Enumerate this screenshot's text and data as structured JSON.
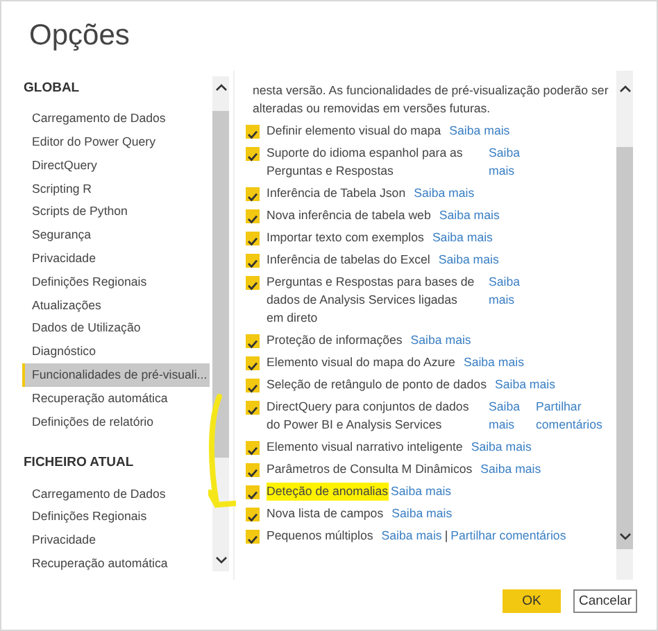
{
  "window": {
    "title": "Opções"
  },
  "sidebar": {
    "sections": [
      {
        "heading": "GLOBAL",
        "items": [
          {
            "label": "Carregamento de Dados",
            "selected": false
          },
          {
            "label": "Editor do Power Query",
            "selected": false
          },
          {
            "label": "DirectQuery",
            "selected": false
          },
          {
            "label": "Scripting R",
            "selected": false
          },
          {
            "label": "Scripts de Python",
            "selected": false
          },
          {
            "label": "Segurança",
            "selected": false
          },
          {
            "label": "Privacidade",
            "selected": false
          },
          {
            "label": "Definições Regionais",
            "selected": false
          },
          {
            "label": "Atualizações",
            "selected": false
          },
          {
            "label": "Dados de Utilização",
            "selected": false
          },
          {
            "label": "Diagnóstico",
            "selected": false
          },
          {
            "label": "Funcionalidades de pré-visuali...",
            "selected": true
          },
          {
            "label": "Recuperação automática",
            "selected": false
          },
          {
            "label": "Definições de relatório",
            "selected": false
          }
        ]
      },
      {
        "heading": "FICHEIRO ATUAL",
        "items": [
          {
            "label": "Carregamento de Dados",
            "selected": false
          },
          {
            "label": "Definições Regionais",
            "selected": false
          },
          {
            "label": "Privacidade",
            "selected": false
          },
          {
            "label": "Recuperação automática",
            "selected": false
          }
        ]
      }
    ]
  },
  "content": {
    "intro": "nesta versão. As funcionalidades de pré-visualização poderão ser alteradas ou removidas em versões futuras.",
    "features": [
      {
        "kind": "inline",
        "label": "Definir elemento visual do mapa",
        "checked": true,
        "highlighted": false,
        "links": [
          "Saiba mais"
        ]
      },
      {
        "kind": "column",
        "label": "Suporte do idioma espanhol para as Perguntas e Respostas",
        "checked": true,
        "highlighted": false,
        "links": [
          "Saiba mais"
        ]
      },
      {
        "kind": "inline",
        "label": "Inferência de Tabela Json",
        "checked": true,
        "highlighted": false,
        "links": [
          "Saiba mais"
        ]
      },
      {
        "kind": "inline",
        "label": "Nova inferência de tabela web",
        "checked": true,
        "highlighted": false,
        "links": [
          "Saiba mais"
        ]
      },
      {
        "kind": "inline",
        "label": "Importar texto com exemplos",
        "checked": true,
        "highlighted": false,
        "links": [
          "Saiba mais"
        ]
      },
      {
        "kind": "inline",
        "label": "Inferência de tabelas do Excel",
        "checked": true,
        "highlighted": false,
        "links": [
          "Saiba mais"
        ]
      },
      {
        "kind": "column",
        "label": "Perguntas e Respostas para bases de dados de Analysis Services ligadas em direto",
        "checked": true,
        "highlighted": false,
        "links": [
          "Saiba mais"
        ]
      },
      {
        "kind": "inline",
        "label": "Proteção de informações",
        "checked": true,
        "highlighted": false,
        "links": [
          "Saiba mais"
        ]
      },
      {
        "kind": "inline",
        "label": "Elemento visual do mapa do Azure",
        "checked": true,
        "highlighted": false,
        "links": [
          "Saiba mais"
        ]
      },
      {
        "kind": "inline",
        "label": "Seleção de retângulo de ponto de dados",
        "checked": true,
        "highlighted": false,
        "links": [
          "Saiba mais"
        ]
      },
      {
        "kind": "column",
        "label": "DirectQuery para conjuntos de dados do Power BI e Analysis Services",
        "checked": true,
        "highlighted": false,
        "links": [
          "Saiba mais",
          "Partilhar comentários"
        ]
      },
      {
        "kind": "inline",
        "label": "Elemento visual narrativo inteligente",
        "checked": true,
        "highlighted": false,
        "links": [
          "Saiba mais"
        ]
      },
      {
        "kind": "inline",
        "label": "Parâmetros de Consulta M Dinâmicos",
        "checked": true,
        "highlighted": false,
        "links": [
          "Saiba mais"
        ]
      },
      {
        "kind": "inline",
        "label": "Deteção de anomalias",
        "checked": true,
        "highlighted": true,
        "links": [
          "Saiba mais"
        ]
      },
      {
        "kind": "inline",
        "label": "Nova lista de campos",
        "checked": true,
        "highlighted": false,
        "links": [
          "Saiba mais"
        ]
      },
      {
        "kind": "inline",
        "label": "Pequenos múltiplos",
        "checked": true,
        "highlighted": false,
        "links": [
          "Saiba mais",
          "Partilhar comentários"
        ],
        "separator": "|"
      }
    ]
  },
  "buttons": [
    {
      "label": "OK",
      "kind": "primary"
    },
    {
      "label": "Cancelar",
      "kind": "secondary"
    }
  ]
}
